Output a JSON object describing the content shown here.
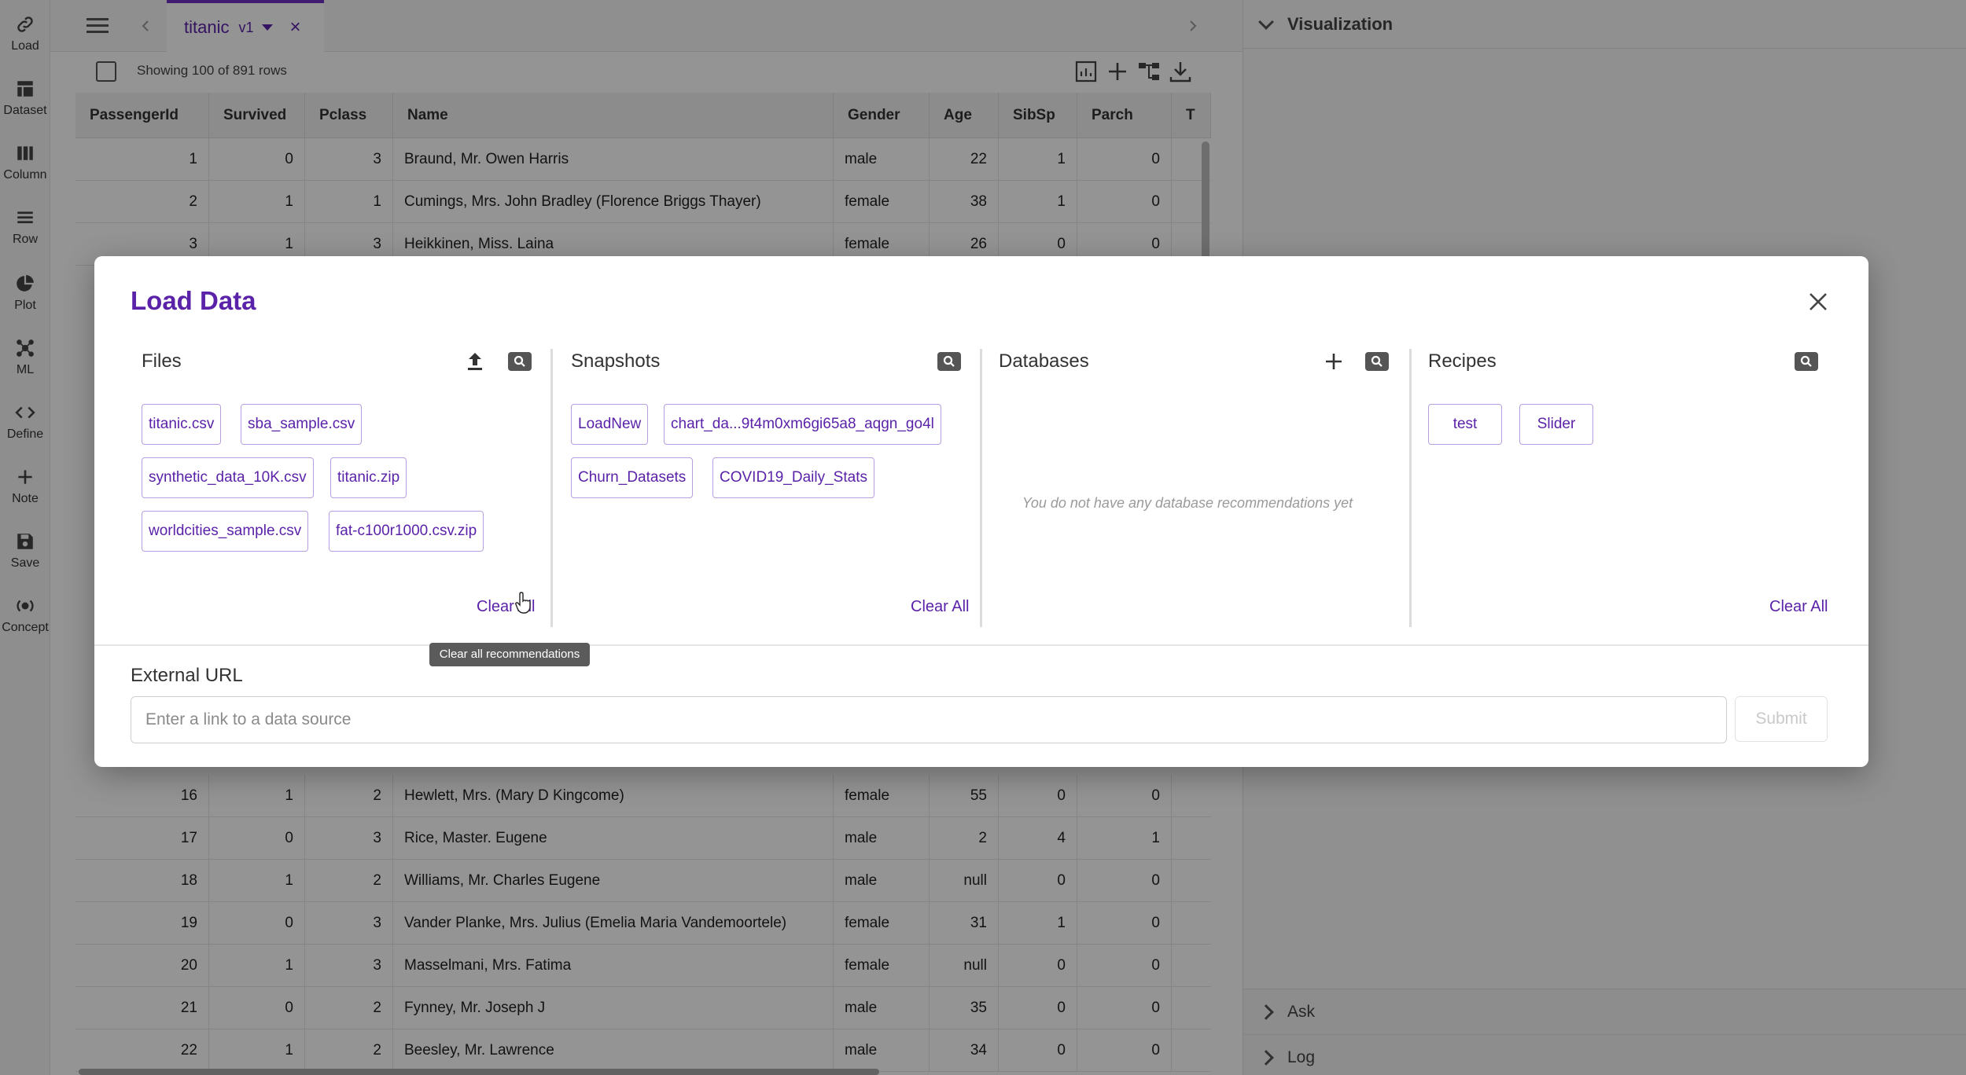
{
  "sidebar": {
    "items": [
      {
        "label": "Load",
        "icon": "link-icon"
      },
      {
        "label": "Dataset",
        "icon": "table-icon"
      },
      {
        "label": "Column",
        "icon": "columns-icon"
      },
      {
        "label": "Row",
        "icon": "rows-icon"
      },
      {
        "label": "Plot",
        "icon": "pie-chart-icon"
      },
      {
        "label": "ML",
        "icon": "network-icon"
      },
      {
        "label": "Define",
        "icon": "code-icon"
      },
      {
        "label": "Note",
        "icon": "plus-icon"
      },
      {
        "label": "Save",
        "icon": "floppy-icon"
      },
      {
        "label": "Concept",
        "icon": "concept-icon"
      }
    ]
  },
  "tab": {
    "name": "titanic",
    "version": "v1",
    "close": "×"
  },
  "toolbar": {
    "showing": "Showing 100 of 891 rows"
  },
  "grid": {
    "columns": [
      "PassengerId",
      "Survived",
      "Pclass",
      "Name",
      "Gender",
      "Age",
      "SibSp",
      "Parch",
      "T"
    ],
    "top_rows": [
      [
        "1",
        "0",
        "3",
        "Braund, Mr. Owen Harris",
        "male",
        "22",
        "1",
        "0"
      ],
      [
        "2",
        "1",
        "1",
        "Cumings, Mrs. John Bradley (Florence Briggs Thayer)",
        "female",
        "38",
        "1",
        "0"
      ],
      [
        "3",
        "1",
        "3",
        "Heikkinen, Miss. Laina",
        "female",
        "26",
        "0",
        "0"
      ]
    ],
    "bottom_rows": [
      [
        "16",
        "1",
        "2",
        "Hewlett, Mrs. (Mary D Kingcome)",
        "female",
        "55",
        "0",
        "0"
      ],
      [
        "17",
        "0",
        "3",
        "Rice, Master. Eugene",
        "male",
        "2",
        "4",
        "1"
      ],
      [
        "18",
        "1",
        "2",
        "Williams, Mr. Charles Eugene",
        "male",
        "null",
        "0",
        "0"
      ],
      [
        "19",
        "0",
        "3",
        "Vander Planke, Mrs. Julius (Emelia Maria Vandemoortele)",
        "female",
        "31",
        "1",
        "0"
      ],
      [
        "20",
        "1",
        "3",
        "Masselmani, Mrs. Fatima",
        "female",
        "null",
        "0",
        "0"
      ],
      [
        "21",
        "0",
        "2",
        "Fynney, Mr. Joseph J",
        "male",
        "35",
        "0",
        "0"
      ],
      [
        "22",
        "1",
        "2",
        "Beesley, Mr. Lawrence",
        "male",
        "34",
        "0",
        "0"
      ]
    ]
  },
  "right_panel": {
    "visualization": "Visualization",
    "ask": "Ask",
    "log": "Log"
  },
  "modal": {
    "title": "Load Data",
    "files": {
      "title": "Files",
      "chips": [
        "titanic.csv",
        "sba_sample.csv",
        "synthetic_data_10K.csv",
        "titanic.zip",
        "worldcities_sample.csv",
        "fat-c100r1000.csv.zip"
      ],
      "clear": "Clear All"
    },
    "snapshots": {
      "title": "Snapshots",
      "chips": [
        "LoadNew",
        "chart_da...9t4m0xm6gi65a8_aqgn_go4l",
        "Churn_Datasets",
        "COVID19_Daily_Stats"
      ],
      "clear": "Clear All"
    },
    "databases": {
      "title": "Databases",
      "empty": "You do not have any database recommendations yet"
    },
    "recipes": {
      "title": "Recipes",
      "chips": [
        "test",
        "Slider"
      ],
      "clear": "Clear All"
    },
    "external": {
      "label": "External URL",
      "placeholder": "Enter a link to a data source",
      "submit": "Submit"
    },
    "tooltip": "Clear all recommendations"
  },
  "colors": {
    "accent": "#5a22a8",
    "chip_border": "#b89ee0"
  }
}
